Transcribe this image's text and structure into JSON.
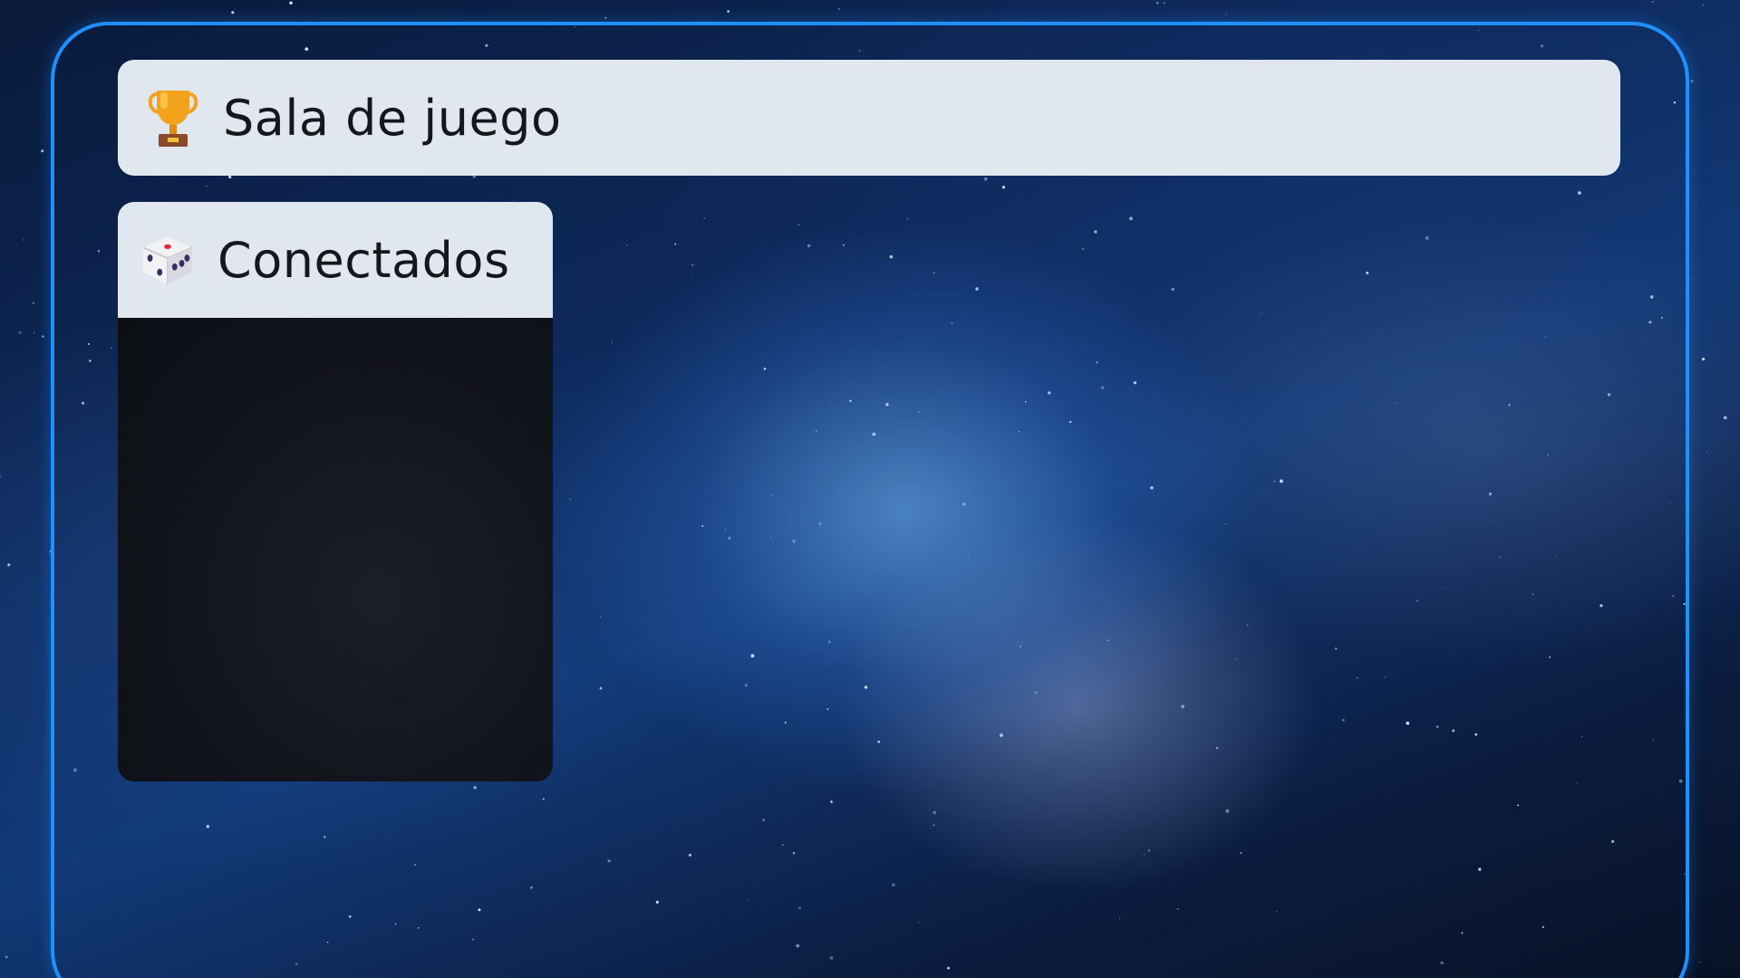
{
  "header": {
    "title": "Sala de juego",
    "icon": "trophy-icon"
  },
  "players_panel": {
    "title": "Conectados",
    "icon": "dice-icon",
    "items": []
  },
  "colors": {
    "frame_border": "#1e90ff",
    "panel_header_bg": "#e1e7ee",
    "panel_body_bg": "#12151b",
    "text": "#15171c"
  }
}
